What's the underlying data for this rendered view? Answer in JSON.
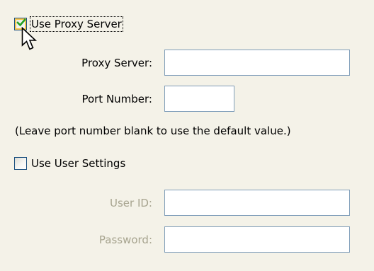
{
  "proxy": {
    "use_proxy_label": "Use Proxy Server",
    "use_proxy_checked": true,
    "proxy_server_label": "Proxy Server:",
    "proxy_server_value": "",
    "port_number_label": "Port Number:",
    "port_number_value": "",
    "hint": "(Leave port number blank to use the default value.)"
  },
  "user": {
    "use_user_settings_label": "Use User Settings",
    "use_user_settings_checked": false,
    "user_id_label": "User ID:",
    "user_id_value": "",
    "password_label": "Password:",
    "password_value": ""
  },
  "icons": {
    "checkmark": "checkmark-icon",
    "cursor": "mouse-pointer-icon"
  },
  "colors": {
    "background": "#f4f2e8",
    "checkmark": "#21a121",
    "checkbox_hover": "#f9c64e",
    "input_border": "#7f9db9",
    "disabled_text": "#a7a48f"
  }
}
